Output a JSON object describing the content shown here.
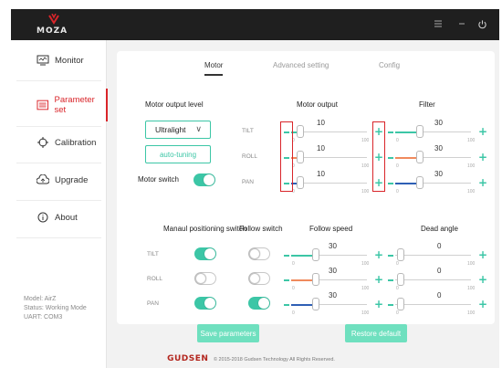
{
  "app": {
    "logo_text": "MOZA"
  },
  "sidebar": {
    "items": [
      {
        "label": "Monitor",
        "icon": "monitor-icon"
      },
      {
        "label": "Parameter set",
        "icon": "parameter-icon",
        "active": true
      },
      {
        "label": "Calibration",
        "icon": "calibration-icon"
      },
      {
        "label": "Upgrade",
        "icon": "upgrade-icon"
      },
      {
        "label": "About",
        "icon": "info-icon"
      }
    ],
    "status": {
      "model": "Model: AirZ",
      "mode": "Status: Working Mode",
      "uart": "UART: COM3"
    }
  },
  "tabs": [
    {
      "label": "Motor",
      "active": true
    },
    {
      "label": "Advanced setting"
    },
    {
      "label": "Config"
    }
  ],
  "motor": {
    "output_level_label": "Motor output level",
    "output_label": "Motor output",
    "filter_label": "Filter",
    "level_value": "Ultralight",
    "auto_tuning_label": "auto-tuning",
    "switch_label": "Motor switch",
    "switch_on": true,
    "axes": [
      {
        "label": "TILT",
        "output": "10",
        "filter": "30"
      },
      {
        "label": "ROLL",
        "output": "10",
        "filter": "30"
      },
      {
        "label": "PAN",
        "output": "10",
        "filter": "30"
      }
    ],
    "slider_min": "0",
    "slider_max": "100"
  },
  "positioning": {
    "manual_label": "Manaul positioning switch",
    "follow_switch_label": "Follow switch",
    "follow_speed_label": "Follow speed",
    "dead_angle_label": "Dead angle",
    "rows": [
      {
        "label": "TILT",
        "manual_on": true,
        "follow_on": false,
        "speed": "30",
        "dead": "0"
      },
      {
        "label": "ROLL",
        "manual_on": false,
        "follow_on": false,
        "speed": "30",
        "dead": "0"
      },
      {
        "label": "PAN",
        "manual_on": true,
        "follow_on": true,
        "speed": "30",
        "dead": "0"
      }
    ]
  },
  "buttons": {
    "save": "Save parameters",
    "restore": "Restore default"
  },
  "footer": {
    "brand": "GUDSEN",
    "copyright": "© 2015-2018 Gudsen Technology All Rights Reserved."
  },
  "colors": {
    "accent": "#3cc6a6",
    "active_nav": "#d9252a",
    "tilt": "#3cc6a6",
    "roll": "#f08a5d",
    "pan": "#2e5fb5",
    "titlebar": "#1f1f1f"
  }
}
